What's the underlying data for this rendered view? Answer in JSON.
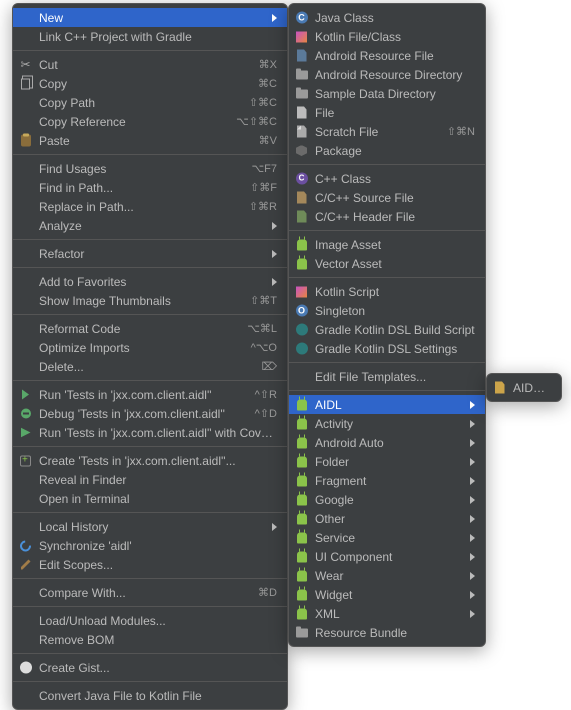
{
  "primary": [
    {
      "type": "item",
      "label": "New",
      "highlight": true,
      "submenu": true
    },
    {
      "type": "item",
      "label": "Link C++ Project with Gradle"
    },
    {
      "type": "sep"
    },
    {
      "type": "item",
      "label": "Cut",
      "shortcut": "⌘X",
      "icon": "cut"
    },
    {
      "type": "item",
      "label": "Copy",
      "shortcut": "⌘C",
      "icon": "copy"
    },
    {
      "type": "item",
      "label": "Copy Path",
      "shortcut": "⇧⌘C"
    },
    {
      "type": "item",
      "label": "Copy Reference",
      "shortcut": "⌥⇧⌘C"
    },
    {
      "type": "item",
      "label": "Paste",
      "shortcut": "⌘V",
      "icon": "paste"
    },
    {
      "type": "sep"
    },
    {
      "type": "item",
      "label": "Find Usages",
      "shortcut": "⌥F7"
    },
    {
      "type": "item",
      "label": "Find in Path...",
      "shortcut": "⇧⌘F"
    },
    {
      "type": "item",
      "label": "Replace in Path...",
      "shortcut": "⇧⌘R"
    },
    {
      "type": "item",
      "label": "Analyze",
      "submenu": true
    },
    {
      "type": "sep"
    },
    {
      "type": "item",
      "label": "Refactor",
      "submenu": true
    },
    {
      "type": "sep"
    },
    {
      "type": "item",
      "label": "Add to Favorites",
      "submenu": true
    },
    {
      "type": "item",
      "label": "Show Image Thumbnails",
      "shortcut": "⇧⌘T"
    },
    {
      "type": "sep"
    },
    {
      "type": "item",
      "label": "Reformat Code",
      "shortcut": "⌥⌘L"
    },
    {
      "type": "item",
      "label": "Optimize Imports",
      "shortcut": "^⌥O"
    },
    {
      "type": "item",
      "label": "Delete...",
      "shortcut": "⌦"
    },
    {
      "type": "sep"
    },
    {
      "type": "item",
      "label": "Run 'Tests in 'jxx.com.client.aidl''",
      "shortcut": "^⇧R",
      "icon": "run"
    },
    {
      "type": "item",
      "label": "Debug 'Tests in 'jxx.com.client.aidl''",
      "shortcut": "^⇧D",
      "icon": "debug"
    },
    {
      "type": "item",
      "label": "Run 'Tests in 'jxx.com.client.aidl'' with Coverage",
      "icon": "runcov"
    },
    {
      "type": "sep"
    },
    {
      "type": "item",
      "label": "Create 'Tests in 'jxx.com.client.aidl''...",
      "icon": "create"
    },
    {
      "type": "item",
      "label": "Reveal in Finder"
    },
    {
      "type": "item",
      "label": "Open in Terminal"
    },
    {
      "type": "sep"
    },
    {
      "type": "item",
      "label": "Local History",
      "submenu": true
    },
    {
      "type": "item",
      "label": "Synchronize 'aidl'",
      "icon": "sync"
    },
    {
      "type": "item",
      "label": "Edit Scopes...",
      "icon": "edit"
    },
    {
      "type": "sep"
    },
    {
      "type": "item",
      "label": "Compare With...",
      "shortcut": "⌘D"
    },
    {
      "type": "sep"
    },
    {
      "type": "item",
      "label": "Load/Unload Modules..."
    },
    {
      "type": "item",
      "label": "Remove BOM"
    },
    {
      "type": "sep"
    },
    {
      "type": "item",
      "label": "Create Gist...",
      "icon": "gh"
    },
    {
      "type": "sep"
    },
    {
      "type": "item",
      "label": "Convert Java File to Kotlin File"
    }
  ],
  "secondary": [
    {
      "type": "item",
      "label": "Java Class",
      "icon": "class",
      "icontxt": "C"
    },
    {
      "type": "item",
      "label": "Kotlin File/Class",
      "icon": "kot"
    },
    {
      "type": "item",
      "label": "Android Resource File",
      "icon": "xmlf"
    },
    {
      "type": "item",
      "label": "Android Resource Directory",
      "icon": "folder"
    },
    {
      "type": "item",
      "label": "Sample Data Directory",
      "icon": "folder"
    },
    {
      "type": "item",
      "label": "File",
      "icon": "file"
    },
    {
      "type": "item",
      "label": "Scratch File",
      "shortcut": "⇧⌘N",
      "icon": "scratch"
    },
    {
      "type": "item",
      "label": "Package",
      "icon": "pkg"
    },
    {
      "type": "sep"
    },
    {
      "type": "item",
      "label": "C++ Class",
      "icon": "cpp",
      "icontxt": "C"
    },
    {
      "type": "item",
      "label": "C/C++ Source File",
      "icon": "cfile"
    },
    {
      "type": "item",
      "label": "C/C++ Header File",
      "icon": "hfile"
    },
    {
      "type": "sep"
    },
    {
      "type": "item",
      "label": "Image Asset",
      "icon": "android"
    },
    {
      "type": "item",
      "label": "Vector Asset",
      "icon": "android"
    },
    {
      "type": "sep"
    },
    {
      "type": "item",
      "label": "Kotlin Script",
      "icon": "kot"
    },
    {
      "type": "item",
      "label": "Singleton",
      "icon": "class",
      "icontxt": "O"
    },
    {
      "type": "item",
      "label": "Gradle Kotlin DSL Build Script",
      "icon": "gradle"
    },
    {
      "type": "item",
      "label": "Gradle Kotlin DSL Settings",
      "icon": "gradle"
    },
    {
      "type": "sep"
    },
    {
      "type": "item",
      "label": "Edit File Templates..."
    },
    {
      "type": "sep"
    },
    {
      "type": "item",
      "label": "AIDL",
      "highlight": true,
      "submenu": true,
      "icon": "android"
    },
    {
      "type": "item",
      "label": "Activity",
      "submenu": true,
      "icon": "android"
    },
    {
      "type": "item",
      "label": "Android Auto",
      "submenu": true,
      "icon": "android"
    },
    {
      "type": "item",
      "label": "Folder",
      "submenu": true,
      "icon": "android"
    },
    {
      "type": "item",
      "label": "Fragment",
      "submenu": true,
      "icon": "android"
    },
    {
      "type": "item",
      "label": "Google",
      "submenu": true,
      "icon": "android"
    },
    {
      "type": "item",
      "label": "Other",
      "submenu": true,
      "icon": "android"
    },
    {
      "type": "item",
      "label": "Service",
      "submenu": true,
      "icon": "android"
    },
    {
      "type": "item",
      "label": "UI Component",
      "submenu": true,
      "icon": "android"
    },
    {
      "type": "item",
      "label": "Wear",
      "submenu": true,
      "icon": "android"
    },
    {
      "type": "item",
      "label": "Widget",
      "submenu": true,
      "icon": "android"
    },
    {
      "type": "item",
      "label": "XML",
      "submenu": true,
      "icon": "android"
    },
    {
      "type": "item",
      "label": "Resource Bundle",
      "icon": "folder"
    }
  ],
  "tertiary": [
    {
      "type": "item",
      "label": "AIDL File",
      "icon": "afile"
    }
  ]
}
